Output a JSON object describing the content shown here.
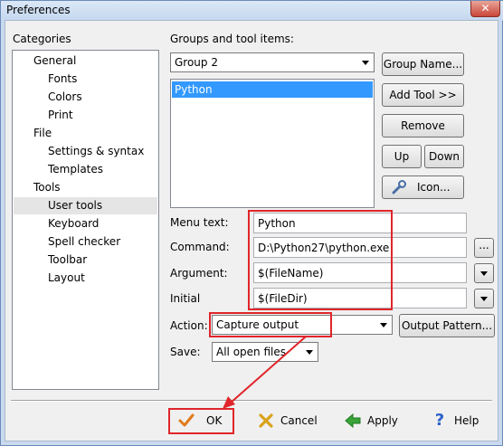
{
  "window": {
    "title": "Preferences",
    "close_glyph": "✕"
  },
  "categories": {
    "label": "Categories",
    "items": [
      {
        "label": "General"
      },
      {
        "label": "Fonts"
      },
      {
        "label": "Colors"
      },
      {
        "label": "Print"
      },
      {
        "label": "File"
      },
      {
        "label": "Settings & syntax"
      },
      {
        "label": "Templates"
      },
      {
        "label": "Tools"
      },
      {
        "label": "User tools",
        "selected": true
      },
      {
        "label": "Keyboard"
      },
      {
        "label": "Spell checker"
      },
      {
        "label": "Toolbar"
      },
      {
        "label": "Layout"
      }
    ]
  },
  "groups": {
    "label": "Groups and tool items:",
    "selected_group": "Group 2",
    "items": [
      "Python"
    ],
    "buttons": {
      "group_name": "Group Name...",
      "add_tool": "Add Tool >>",
      "remove": "Remove",
      "up": "Up",
      "down": "Down",
      "icon": "Icon..."
    }
  },
  "fields": {
    "menu_text": {
      "label": "Menu text:",
      "value": "Python"
    },
    "command": {
      "label": "Command:",
      "value": "D:\\Python27\\python.exe",
      "browse": "..."
    },
    "argument": {
      "label": "Argument:",
      "value": "$(FileName)"
    },
    "initial": {
      "label": "Initial",
      "value": "$(FileDir)"
    },
    "action": {
      "label": "Action:",
      "value": "Capture output",
      "pattern_button": "Output Pattern..."
    },
    "save": {
      "label": "Save:",
      "value": "All open files"
    }
  },
  "footer": {
    "ok": "OK",
    "cancel": "Cancel",
    "apply": "Apply",
    "help": "Help"
  },
  "colors": {
    "annotation_red": "#e0262b",
    "selection_blue": "#3399ff",
    "ok_check": "#e07a1c",
    "cancel_x": "#d9a21b",
    "apply_arrow": "#3aa33a",
    "help_mark": "#2c63c9"
  }
}
